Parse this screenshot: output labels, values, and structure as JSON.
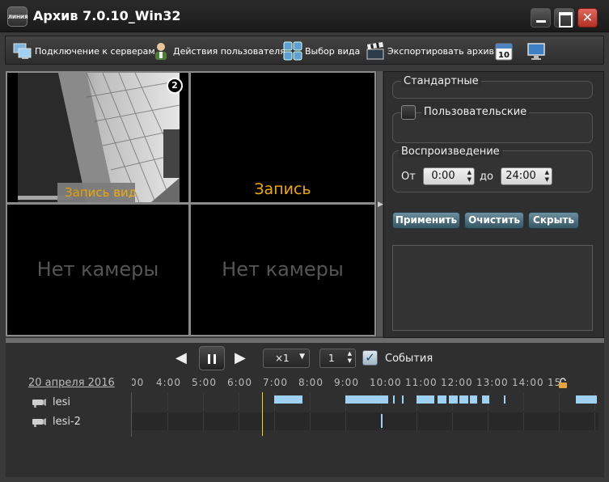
{
  "window": {
    "title": "Архив 7.0.10_Win32",
    "logo_text": "ЛИНИЯ"
  },
  "toolbar": {
    "connect_label": "Подключение к серверам",
    "user_actions_label": "Действия пользователя",
    "view_select_label": "Выбор вида",
    "export_label": "Экспортировать архив",
    "calendar_day": "10"
  },
  "video": {
    "cells": [
      {
        "label": "Запись видео",
        "has_camera": true,
        "badge": "2"
      },
      {
        "label": "Запись",
        "has_camera": true
      },
      {
        "label": "Нет камеры",
        "has_camera": false
      },
      {
        "label": "Нет камеры",
        "has_camera": false
      }
    ]
  },
  "filters": {
    "standard_title": "Стандартные",
    "custom_title": "Пользовательские",
    "playback_title": "Воспроизведение",
    "from_label": "От",
    "to_label": "до",
    "from_value": "0:00",
    "to_value": "24:00",
    "apply_label": "Применить",
    "clear_label": "Очистить",
    "hide_label": "Скрыть"
  },
  "playback": {
    "speed_value": "×1",
    "step_value": "1",
    "events_label": "События",
    "events_checked": true
  },
  "timeline": {
    "date": "20 апреля 2016",
    "hours": [
      "00",
      "4:00",
      "5:00",
      "6:00",
      "7:00",
      "8:00",
      "9:00",
      "10:00",
      "11:00",
      "12:00",
      "13:00",
      "14:00",
      "15"
    ],
    "cameras": [
      {
        "name": "lesi",
        "segments": [
          [
            7.0,
            7.8
          ],
          [
            9.0,
            10.2
          ],
          [
            10.35,
            10.38
          ],
          [
            10.6,
            10.63
          ],
          [
            11.0,
            11.5
          ],
          [
            11.6,
            11.85
          ],
          [
            11.9,
            12.15
          ],
          [
            12.2,
            12.45
          ],
          [
            12.5,
            12.7
          ],
          [
            12.85,
            13.05
          ],
          [
            13.45,
            13.48
          ],
          [
            16.2,
            16.8
          ]
        ]
      },
      {
        "name": "lesi-2",
        "segments": [
          [
            10.0,
            10.05
          ]
        ]
      }
    ]
  },
  "colors": {
    "accent": "#f0a800",
    "segment": "#9fd1f2",
    "cursor": "#f2d600",
    "button": "#4f7482"
  }
}
